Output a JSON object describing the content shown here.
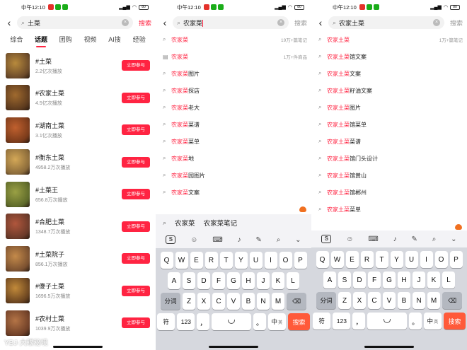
{
  "status": {
    "time": "中午12:10",
    "battery": "80",
    "app_icon_colors": [
      "#e4312b",
      "#1aad19",
      "#1aad19"
    ]
  },
  "panel1": {
    "query": "土菜",
    "search_label": "搜索",
    "tabs": [
      {
        "label": "综合"
      },
      {
        "label": "话题"
      },
      {
        "label": "团购"
      },
      {
        "label": "视频"
      },
      {
        "label": "AI搜"
      },
      {
        "label": "经验"
      }
    ],
    "active_tab": "话题",
    "join_label": "立即参与",
    "topics": [
      {
        "title": "#土菜",
        "plays": "2.2亿次播放"
      },
      {
        "title": "#农家土菜",
        "plays": "4.5亿次播放"
      },
      {
        "title": "#湖南土菜",
        "plays": "3.1亿次播放"
      },
      {
        "title": "#衡东土菜",
        "plays": "4958.2万次播放"
      },
      {
        "title": "#土菜王",
        "plays": "656.8万次播放"
      },
      {
        "title": "#合肥土菜",
        "plays": "1348.7万次播放"
      },
      {
        "title": "#土菜院子",
        "plays": "856.1万次播放"
      },
      {
        "title": "#傻子土菜",
        "plays": "1696.5万次播放"
      },
      {
        "title": "#农村土菜",
        "plays": "1039.9万次播放"
      }
    ],
    "watermark": "YBJ·大眼秘境"
  },
  "panel2": {
    "query": "农家菜",
    "search_label": "搜索",
    "suggestions": [
      {
        "key": "农家菜",
        "rest": "",
        "meta": "19万+篇笔记",
        "icon": "mag"
      },
      {
        "key": "农家菜",
        "rest": "",
        "meta": "1万+件商品",
        "icon": "doc"
      },
      {
        "key": "农家菜",
        "rest": "图片",
        "meta": "",
        "icon": "mag"
      },
      {
        "key": "农家菜",
        "rest": "探店",
        "meta": "",
        "icon": "mag"
      },
      {
        "key": "农家菜",
        "rest": "老大",
        "meta": "",
        "icon": "mag"
      },
      {
        "key": "农家菜",
        "rest": "菜谱",
        "meta": "",
        "icon": "mag"
      },
      {
        "key": "农家菜",
        "rest": "菜单",
        "meta": "",
        "icon": "mag"
      },
      {
        "key": "农家菜",
        "rest": "地",
        "meta": "",
        "icon": "mag"
      },
      {
        "key": "农家菜",
        "rest": "园图片",
        "meta": "",
        "icon": "mag"
      },
      {
        "key": "农家菜",
        "rest": "文案",
        "meta": "",
        "icon": "mag"
      }
    ],
    "candidates": [
      "农家菜",
      "农家菜笔记"
    ]
  },
  "panel3": {
    "query": "农家土菜",
    "search_label": "搜索",
    "suggestions": [
      {
        "key": "农家土菜",
        "rest": "",
        "meta": "1万+篇笔记"
      },
      {
        "key": "农家土菜",
        "rest": "馆文案",
        "meta": ""
      },
      {
        "key": "农家土菜",
        "rest": "文案",
        "meta": ""
      },
      {
        "key": "农家土菜",
        "rest": "籽油文案",
        "meta": ""
      },
      {
        "key": "农家土菜",
        "rest": "图片",
        "meta": ""
      },
      {
        "key": "农家土菜",
        "rest": "馆菜单",
        "meta": ""
      },
      {
        "key": "农家土菜",
        "rest": "菜谱",
        "meta": ""
      },
      {
        "key": "农家土菜",
        "rest": "馆门头设计",
        "meta": ""
      },
      {
        "key": "农家土菜",
        "rest": "馆黄山",
        "meta": ""
      },
      {
        "key": "农家土菜",
        "rest": "馆郴州",
        "meta": ""
      },
      {
        "key": "农家土菜",
        "rest": "菜单",
        "meta": ""
      }
    ]
  },
  "keyboard": {
    "row1": [
      "Q",
      "W",
      "E",
      "R",
      "T",
      "Y",
      "U",
      "I",
      "O",
      "P"
    ],
    "row2": [
      "A",
      "S",
      "D",
      "F",
      "G",
      "H",
      "J",
      "K",
      "L"
    ],
    "row3_left": "分词",
    "row3": [
      "Z",
      "X",
      "C",
      "V",
      "B",
      "N",
      "M"
    ],
    "backspace_symbol": "⌫",
    "sym_key": "符",
    "num_key": "123",
    "comma": "，",
    "period": "。",
    "lang_key": "中",
    "lang_sub": "英",
    "enter_key": "搜索",
    "enter_color": "#ff5a3a"
  },
  "colors": {
    "accent": "#ff2442",
    "keyboard_bg": "#d6d8de"
  }
}
